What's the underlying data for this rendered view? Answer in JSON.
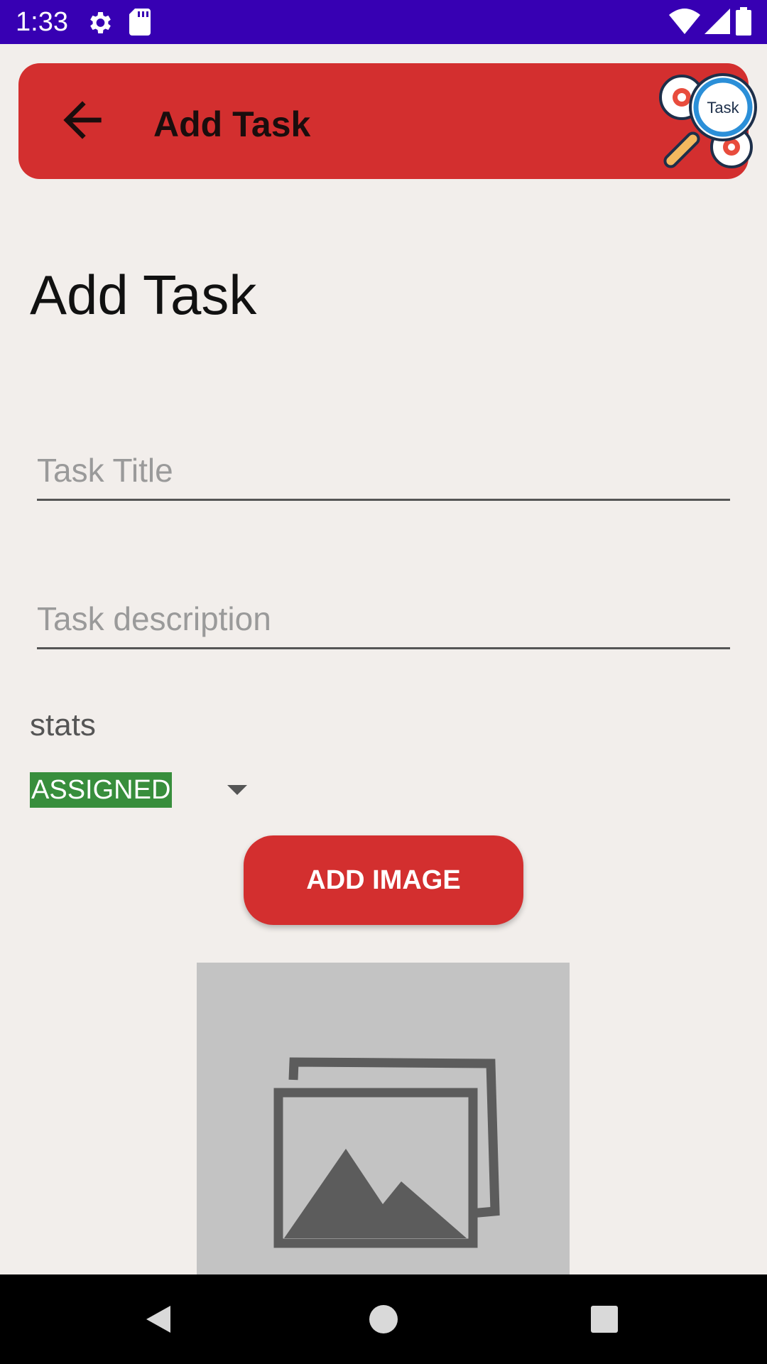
{
  "status_bar": {
    "time": "1:33",
    "icons": [
      "gear-icon",
      "sd-card-icon",
      "wifi-icon",
      "signal-icon",
      "battery-icon"
    ],
    "background": "#3700b3"
  },
  "app_bar": {
    "title": "Add Task",
    "back_icon": "arrow-back-icon",
    "logo_text": "Task",
    "background": "#d32f2f"
  },
  "page": {
    "heading": "Add Task"
  },
  "form": {
    "title_placeholder": "Task Title",
    "title_value": "",
    "description_placeholder": "Task description",
    "description_value": "",
    "stats_label": "stats",
    "stats_selected": "ASSIGNED",
    "stats_selected_color": "#388e3c",
    "add_image_label": "ADD IMAGE"
  },
  "image_preview": {
    "icon": "image-placeholder-icon"
  },
  "nav_bar": {
    "icons": [
      "back-triangle-icon",
      "home-circle-icon",
      "recents-square-icon"
    ]
  }
}
